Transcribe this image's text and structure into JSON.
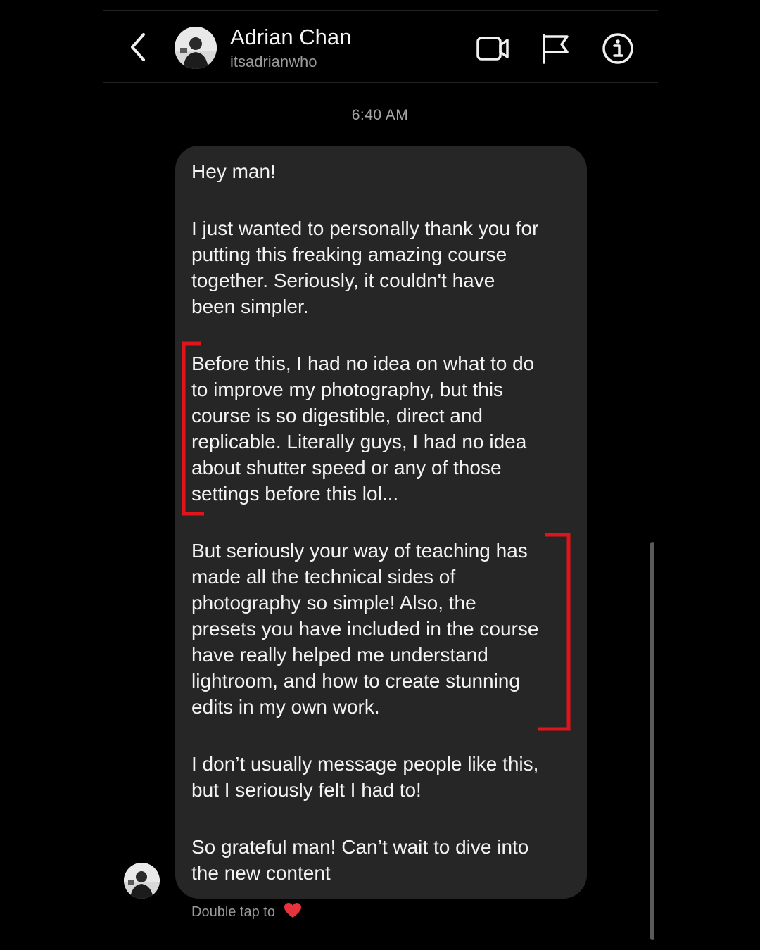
{
  "header": {
    "contact_name": "Adrian Chan",
    "contact_handle": "itsadrianwho"
  },
  "icons": {
    "back": "chevron-left-icon",
    "video": "video-camera-icon",
    "flag": "flag-icon",
    "info": "info-icon",
    "heart": "heart-icon"
  },
  "conversation": {
    "timestamp": "6:40 AM",
    "message": {
      "paragraphs": [
        "Hey man!",
        "I just wanted to personally thank you for\nputting this freaking amazing course\ntogether. Seriously, it couldn't have\nbeen simpler.",
        "Before this, I had no idea on what to do\nto improve my photography, but this\ncourse is so digestible, direct and\nreplicable. Literally guys, I had no idea\nabout shutter speed or any of those\nsettings before this lol...",
        "But seriously your way of teaching has\nmade all the technical sides of\nphotography so simple! Also, the\npresets you have included in the course\nhave really helped me understand\nlightroom, and how to create stunning\nedits in my own work.",
        "I don’t usually message people like this,\nbut I seriously felt I had to!",
        "So grateful man! Can’t wait to dive into\nthe new content"
      ]
    },
    "reaction_hint": "Double tap to"
  },
  "colors": {
    "background": "#000000",
    "bubble": "#262626",
    "text": "#f3f3f3",
    "muted": "#9a9a9a",
    "highlight_bracket": "#e0141a",
    "heart": "#e8323c"
  }
}
